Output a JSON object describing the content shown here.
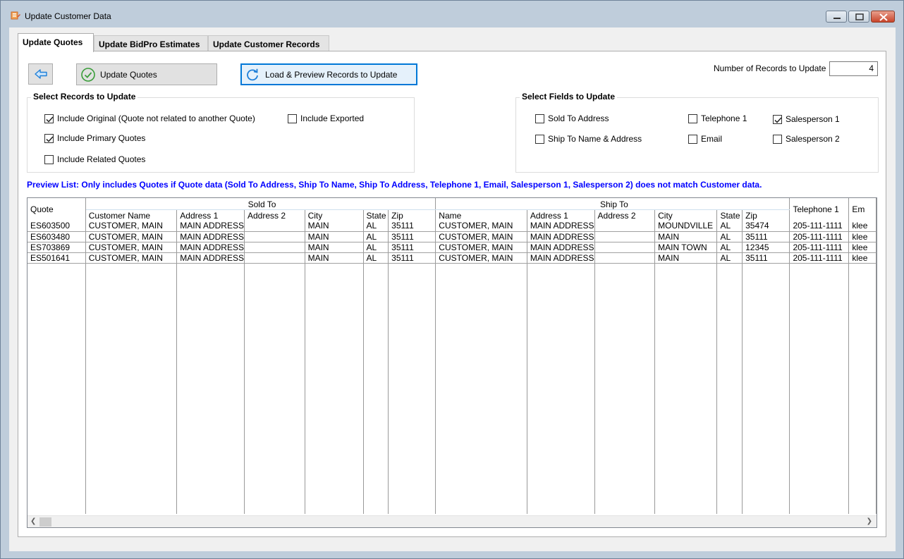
{
  "window": {
    "title": "Update Customer Data"
  },
  "tabs": [
    {
      "label": "Update Quotes"
    },
    {
      "label": "Update BidPro Estimates"
    },
    {
      "label": "Update Customer Records"
    }
  ],
  "toolbar": {
    "back_icon": "arrow-left-icon",
    "update_label": "Update Quotes",
    "update_icon": "check-circle-icon",
    "load_label": "Load & Preview Records to Update",
    "load_icon": "refresh-icon"
  },
  "num_records": {
    "label": "Number of Records to Update",
    "value": "4"
  },
  "select_records": {
    "title": "Select Records to Update",
    "options": [
      {
        "label": "Include Original (Quote not related to another Quote)",
        "checked": true
      },
      {
        "label": "Include Primary Quotes",
        "checked": true
      },
      {
        "label": "Include Related Quotes",
        "checked": false
      },
      {
        "label": "Include Exported",
        "checked": false
      }
    ]
  },
  "select_fields": {
    "title": "Select Fields to Update",
    "options": [
      {
        "label": "Sold To Address",
        "checked": false
      },
      {
        "label": "Ship To Name & Address",
        "checked": false
      },
      {
        "label": "Telephone 1",
        "checked": false
      },
      {
        "label": "Email",
        "checked": false
      },
      {
        "label": "Salesperson 1",
        "checked": true
      },
      {
        "label": "Salesperson 2",
        "checked": false
      }
    ]
  },
  "preview_note": "Preview List:  Only includes Quotes if Quote data (Sold To Address, Ship To Name, Ship To Address, Telephone 1, Email, Salesperson 1, Salesperson 2) does not match Customer data.",
  "grid": {
    "group_headers": {
      "sold_to": "Sold To",
      "ship_to": "Ship To"
    },
    "columns": {
      "quote": "Quote",
      "customer_name": "Customer Name",
      "address1": "Address 1",
      "address2": "Address 2",
      "city": "City",
      "state": "State",
      "zip": "Zip",
      "ship_name": "Name",
      "ship_address1": "Address 1",
      "ship_address2": "Address 2",
      "ship_city": "City",
      "ship_state": "State",
      "ship_zip": "Zip",
      "telephone1": "Telephone 1",
      "email": "Em"
    },
    "rows": [
      [
        "ES603500",
        "CUSTOMER, MAIN",
        "MAIN ADDRESS",
        "",
        "MAIN",
        "AL",
        "35111",
        "CUSTOMER, MAIN",
        "MAIN ADDRESS",
        "",
        "MOUNDVILLE",
        "AL",
        "35474",
        "205-111-1111",
        "klee"
      ],
      [
        "ES603480",
        "CUSTOMER, MAIN",
        "MAIN ADDRESS",
        "",
        "MAIN",
        "AL",
        "35111",
        "CUSTOMER, MAIN",
        "MAIN ADDRESS",
        "",
        "MAIN",
        "AL",
        "35111",
        "205-111-1111",
        "klee"
      ],
      [
        "ES703869",
        "CUSTOMER, MAIN",
        "MAIN ADDRESS",
        "",
        "MAIN",
        "AL",
        "35111",
        "CUSTOMER, MAIN",
        "MAIN ADDRESS",
        "",
        "MAIN TOWN",
        "AL",
        "12345",
        "205-111-1111",
        "klee"
      ],
      [
        "ES501641",
        "CUSTOMER, MAIN",
        "MAIN ADDRESS",
        "",
        "MAIN",
        "AL",
        "35111",
        "CUSTOMER, MAIN",
        "MAIN ADDRESS",
        "",
        "MAIN",
        "AL",
        "35111",
        "205-111-1111",
        "klee"
      ]
    ]
  },
  "colors": {
    "titlebar": "#bfcddb",
    "accent": "#0078d7",
    "preview_note": "#0000ff",
    "check_icon": "#3a9d3a",
    "back_arrow": "#1e7fd8"
  }
}
